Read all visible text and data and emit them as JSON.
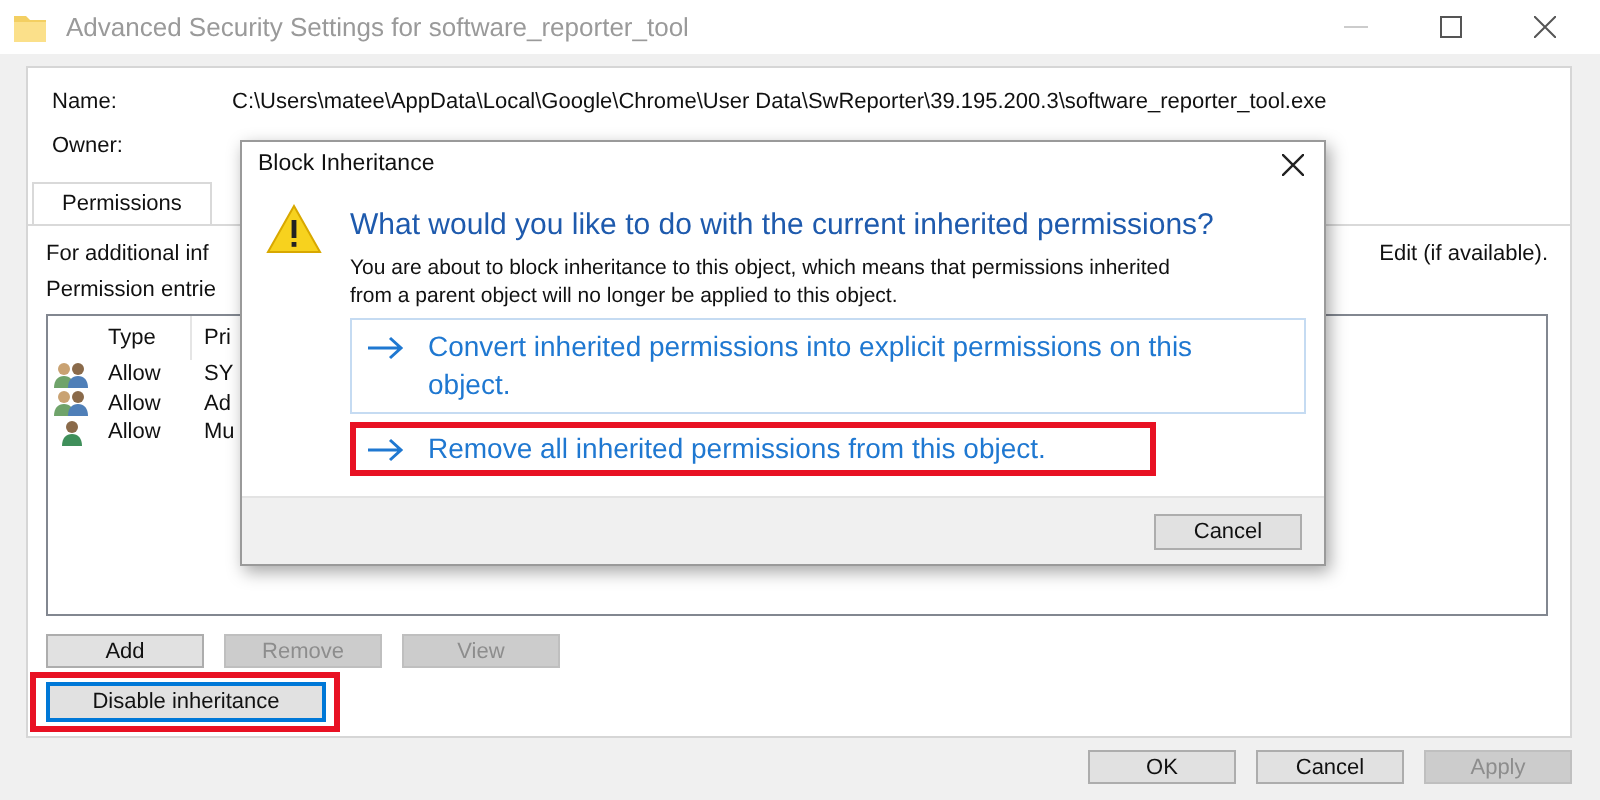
{
  "window": {
    "title": "Advanced Security Settings for software_reporter_tool"
  },
  "name": {
    "label": "Name:",
    "value": "C:\\Users\\matee\\AppData\\Local\\Google\\Chrome\\User Data\\SwReporter\\39.195.200.3\\software_reporter_tool.exe"
  },
  "owner": {
    "label": "Owner:"
  },
  "tabs": [
    {
      "label": "Permissions",
      "selected": true
    }
  ],
  "info_left": "For additional inf",
  "info_right": "Edit (if available).",
  "entries_label": "Permission entrie",
  "entries": {
    "columns": [
      "Type",
      "Pri"
    ],
    "rows": [
      {
        "kind": "group",
        "type": "Allow",
        "principal": "SY"
      },
      {
        "kind": "group",
        "type": "Allow",
        "principal": "Ad"
      },
      {
        "kind": "user",
        "type": "Allow",
        "principal": "Mu"
      }
    ]
  },
  "entry_buttons": [
    {
      "label": "Add",
      "disabled": false
    },
    {
      "label": "Remove",
      "disabled": true
    },
    {
      "label": "View",
      "disabled": true
    }
  ],
  "inheritance_button": {
    "label": "Disable inheritance",
    "focused": true,
    "highlighted": true
  },
  "footer_buttons": [
    {
      "label": "OK",
      "disabled": false
    },
    {
      "label": "Cancel",
      "disabled": false
    },
    {
      "label": "Apply",
      "disabled": true
    }
  ],
  "dialog": {
    "title": "Block Inheritance",
    "heading": "What would you like to do with the current inherited permissions?",
    "message": "You are about to block inheritance to this object, which means that permissions inherited from a parent object will no longer be applied to this object.",
    "options": [
      {
        "label": "Convert inherited permissions into explicit permissions on this object.",
        "hovered": true,
        "highlighted": false
      },
      {
        "label": "Remove all inherited permissions from this object.",
        "hovered": false,
        "highlighted": true
      }
    ],
    "cancel": "Cancel"
  }
}
